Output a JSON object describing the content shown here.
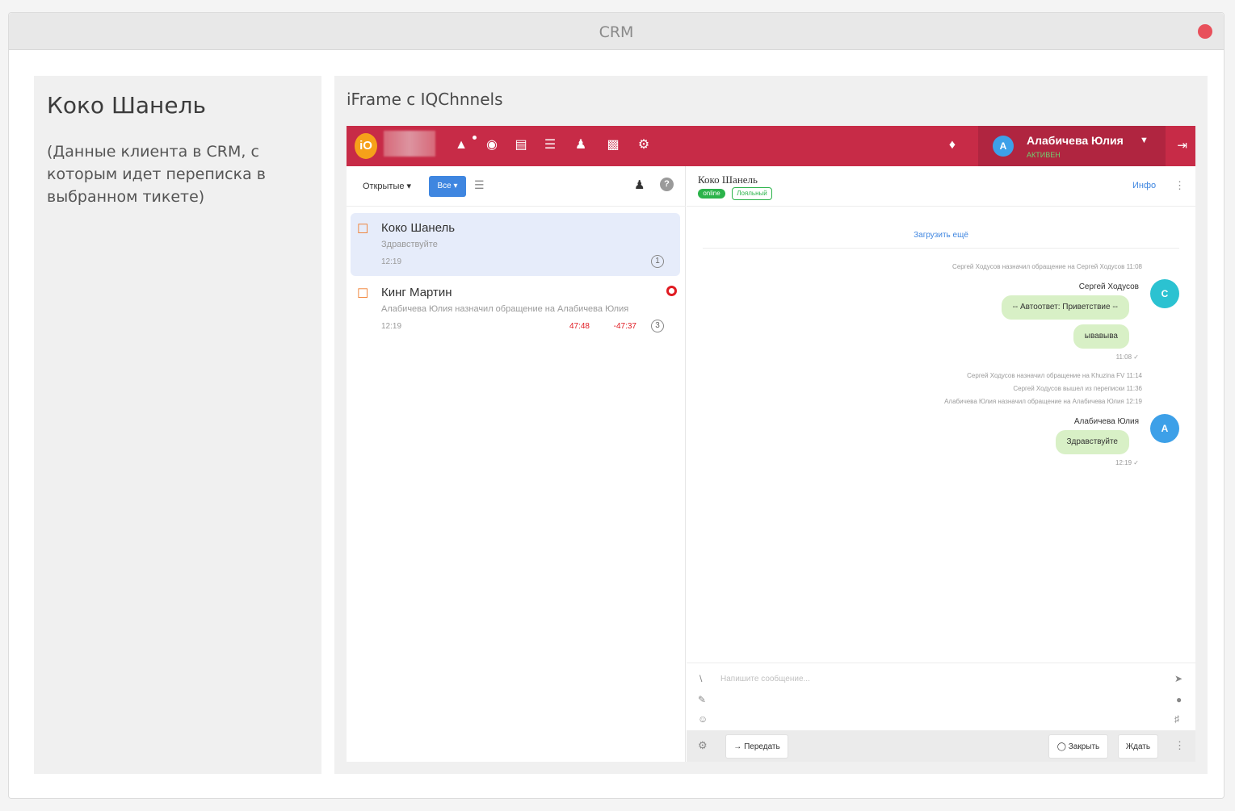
{
  "window": {
    "title": "CRM"
  },
  "client": {
    "name": "Коко Шанель",
    "description": "(Данные клиента в CRM, с которым идет переписка в выбранном тикете)"
  },
  "iframe": {
    "title": "iFrame с IQChnnels"
  },
  "topbar": {
    "logo": "iO",
    "user": {
      "avatar": "A",
      "name": "Алабичева Юлия",
      "status": "АКТИВЕН"
    }
  },
  "filters": {
    "open": "Открытые ▾",
    "all": "Все ▾"
  },
  "tickets": [
    {
      "name": "Коко Шанель",
      "preview": "Здравствуйте",
      "time": "12:19",
      "count": "1"
    },
    {
      "name": "Кинг Мартин",
      "preview": "Алабичева Юлия назначил обращение на Алабичева Юлия",
      "time": "12:19",
      "timer1": "47:48",
      "timer2": "-47:37",
      "count": "3"
    }
  ],
  "chat": {
    "header": {
      "name": "Коко Шанель",
      "online": "online",
      "loyal": "Лояльный",
      "info": "Инфо"
    },
    "load_more": "Загрузить ещё",
    "system": [
      "Сергей Ходусов назначил обращение на Сергей Ходусов 11:08",
      "Сергей Ходусов назначил обращение на Khuzina FV 11:14",
      "Сергей Ходусов вышел из переписки 11:36",
      "Алабичева Юлия назначил обращение на Алабичева Юлия 12:19"
    ],
    "msg1": {
      "sender": "Сергей Ходусов",
      "avatar": "С",
      "text1": "-- Автоответ: Приветствие --",
      "text2": "ывавыва",
      "time": "11:08 ✓"
    },
    "msg2": {
      "sender": "Алабичева Юлия",
      "avatar": "А",
      "text": "Здравствуйте",
      "time": "12:19 ✓"
    },
    "composer_placeholder": "Напишите сообщение..."
  },
  "footer": {
    "transfer": "→ Передать",
    "close": "◯ Закрыть",
    "wait": "Ждать"
  },
  "colors": {
    "topbar": "#c72b47",
    "accent": "#3f86e0",
    "bubble": "#d8f0c6",
    "online": "#2bb34a",
    "alert": "#e01b22"
  }
}
